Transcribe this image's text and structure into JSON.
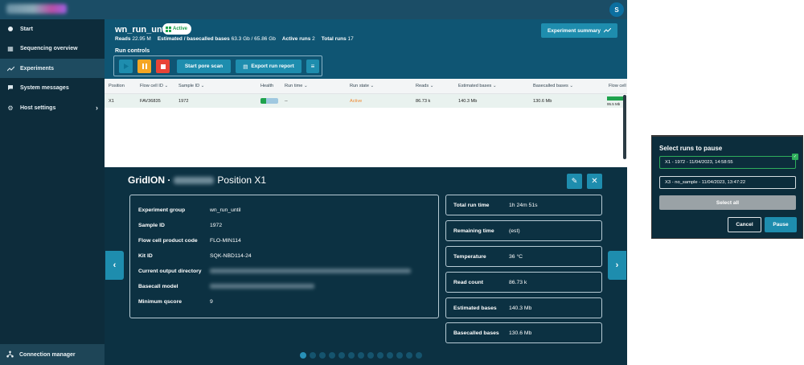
{
  "topbar": {
    "avatar_initial": "S"
  },
  "sidebar": {
    "items": [
      {
        "label": "Start",
        "icon": "play-circle-icon"
      },
      {
        "label": "Sequencing overview",
        "icon": "grid-icon"
      },
      {
        "label": "Experiments",
        "icon": "trend-icon"
      },
      {
        "label": "System messages",
        "icon": "message-icon"
      },
      {
        "label": "Host settings",
        "icon": "gear-icon"
      }
    ],
    "connection": "Connection manager"
  },
  "header": {
    "title": "wn_run_until",
    "status": "Active",
    "stats": {
      "reads_label": "Reads",
      "reads_value": "22.95 M",
      "bases_label": "Estimated / basecalled bases",
      "bases_value": "63.3 Gb / 65.86 Gb",
      "active_label": "Active runs",
      "active_value": "2",
      "total_label": "Total runs",
      "total_value": "17"
    },
    "run_controls_label": "Run controls",
    "start_pore_scan": "Start pore scan",
    "export_report": "Export run report",
    "experiment_summary": "Experiment summary"
  },
  "table": {
    "columns": [
      "Position",
      "Flow cell ID",
      "Sample ID",
      "Health",
      "Run time",
      "Run state",
      "Reads",
      "Estimated bases",
      "Basecalled bases",
      "Flow cell"
    ],
    "row": {
      "position": "X1",
      "flow_cell_id": "FAV36835",
      "sample_id": "1972",
      "run_time": "--",
      "run_state": "Active",
      "reads": "86.73 k",
      "estimated_bases": "140.3 Mb",
      "basecalled_bases": "130.6 Mb",
      "flow_cell_pct": "95.5 Mb"
    },
    "run_state_color": "#f0872f"
  },
  "detail": {
    "device": "GridION ·",
    "position": "Position X1",
    "info": [
      {
        "key": "Experiment group",
        "value": "wn_run_until"
      },
      {
        "key": "Sample ID",
        "value": "1972"
      },
      {
        "key": "Flow cell product code",
        "value": "FLO-MIN114"
      },
      {
        "key": "Kit ID",
        "value": "SQK-NBD114-24"
      },
      {
        "key": "Current output directory",
        "value": ""
      },
      {
        "key": "Basecall model",
        "value": ""
      },
      {
        "key": "Minimum qscore",
        "value": "9"
      }
    ],
    "metrics": [
      {
        "key": "Total run time",
        "value": "1h 24m 51s"
      },
      {
        "key": "Remaining time",
        "value": "(est)"
      },
      {
        "key": "Temperature",
        "value": "36 °C"
      },
      {
        "key": "Read count",
        "value": "86.73 k"
      },
      {
        "key": "Estimated bases",
        "value": "140.3 Mb"
      },
      {
        "key": "Basecalled bases",
        "value": "130.6 Mb"
      }
    ]
  },
  "popup": {
    "title": "Select runs to pause",
    "runs": [
      {
        "label": "X1 - 1972 - 11/04/2023, 14:58:55",
        "selected": true
      },
      {
        "label": "X3 - no_sample - 11/04/2023, 13:47:22",
        "selected": false
      }
    ],
    "select_all": "Select all",
    "cancel": "Cancel",
    "confirm": "Pause"
  },
  "colors": {
    "accent": "#1e8dae",
    "active_green": "#1fa34d",
    "pause_orange": "#f5a623",
    "stop_red": "#e84437"
  }
}
